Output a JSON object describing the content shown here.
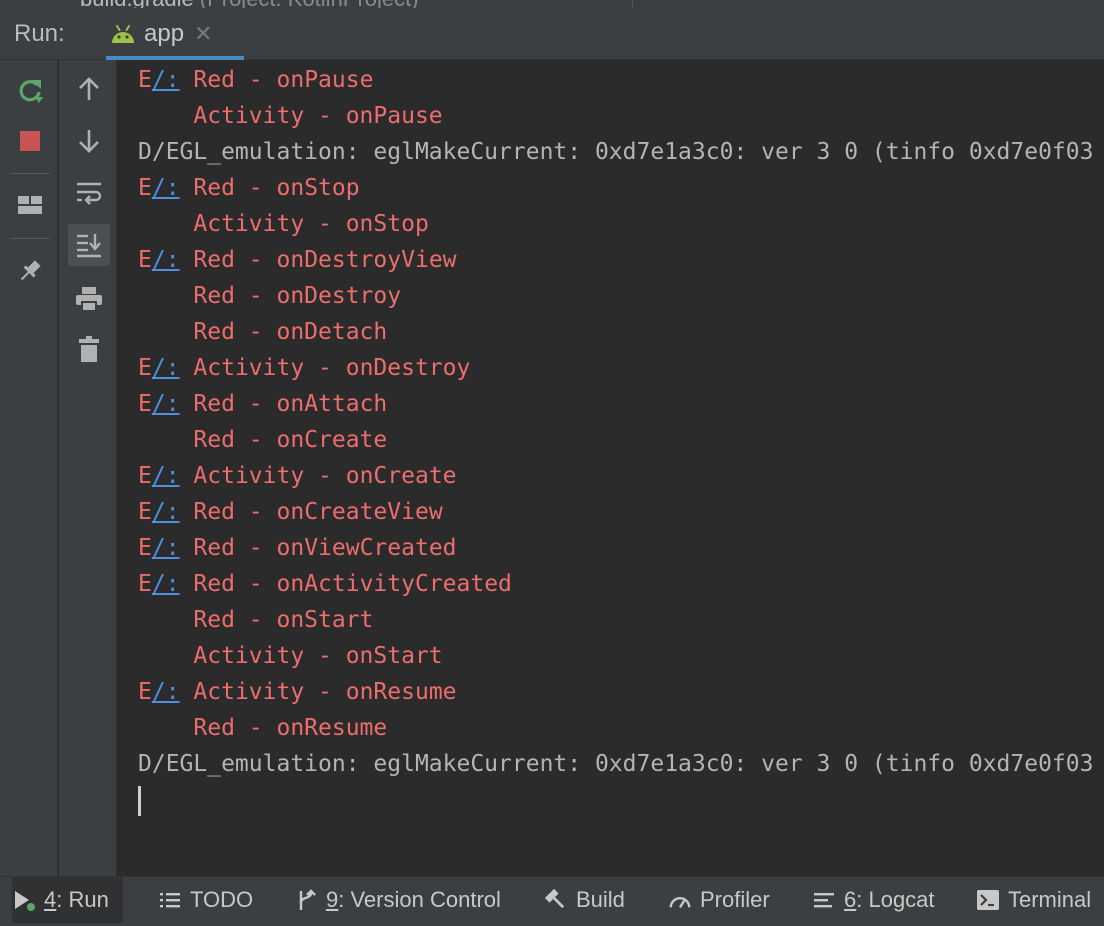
{
  "editor_tab": {
    "label": "build.gradle",
    "project": "(Project: KotlinProject)"
  },
  "header": {
    "run_label": "Run:",
    "tab_label": "app"
  },
  "toolbar": {
    "rerun_tooltip": "Rerun 'app'",
    "stop_tooltip": "Stop 'app'"
  },
  "console": {
    "lines": [
      {
        "level": "E",
        "tag": "/:",
        "text": "Red - onPause"
      },
      {
        "level": "",
        "tag": "",
        "text": "Activity - onPause"
      },
      {
        "level": "D",
        "tag": "",
        "text": "D/EGL_emulation: eglMakeCurrent: 0xd7e1a3c0: ver 3 0 (tinfo 0xd7e0f03"
      },
      {
        "level": "E",
        "tag": "/:",
        "text": "Red - onStop"
      },
      {
        "level": "",
        "tag": "",
        "text": "Activity - onStop"
      },
      {
        "level": "E",
        "tag": "/:",
        "text": "Red - onDestroyView"
      },
      {
        "level": "",
        "tag": "",
        "text": "Red - onDestroy"
      },
      {
        "level": "",
        "tag": "",
        "text": "Red - onDetach"
      },
      {
        "level": "E",
        "tag": "/:",
        "text": "Activity - onDestroy"
      },
      {
        "level": "E",
        "tag": "/:",
        "text": "Red - onAttach"
      },
      {
        "level": "",
        "tag": "",
        "text": "Red - onCreate"
      },
      {
        "level": "E",
        "tag": "/:",
        "text": "Activity - onCreate"
      },
      {
        "level": "E",
        "tag": "/:",
        "text": "Red - onCreateView"
      },
      {
        "level": "E",
        "tag": "/:",
        "text": "Red - onViewCreated"
      },
      {
        "level": "E",
        "tag": "/:",
        "text": "Red - onActivityCreated"
      },
      {
        "level": "",
        "tag": "",
        "text": "Red - onStart"
      },
      {
        "level": "",
        "tag": "",
        "text": "Activity - onStart"
      },
      {
        "level": "E",
        "tag": "/:",
        "text": "Activity - onResume"
      },
      {
        "level": "",
        "tag": "",
        "text": "Red - onResume"
      },
      {
        "level": "D",
        "tag": "",
        "text": "D/EGL_emulation: eglMakeCurrent: 0xd7e1a3c0: ver 3 0 (tinfo 0xd7e0f03"
      }
    ]
  },
  "bottom_bar": {
    "run": {
      "num": "4",
      "label": ": Run"
    },
    "todo": {
      "label": "TODO"
    },
    "vcs": {
      "num": "9",
      "label": ": Version Control"
    },
    "build": {
      "label": "Build"
    },
    "profiler": {
      "label": "Profiler"
    },
    "logcat": {
      "num": "6",
      "label": ": Logcat"
    },
    "terminal": {
      "label": "Terminal"
    }
  },
  "colors": {
    "error": "#ec6d6d",
    "debug": "#b4b4b4",
    "link": "#4e8ede",
    "accent": "#4a88c7",
    "android_green": "#9fc24a",
    "rerun_green": "#59a869",
    "stop_red": "#c75450"
  }
}
